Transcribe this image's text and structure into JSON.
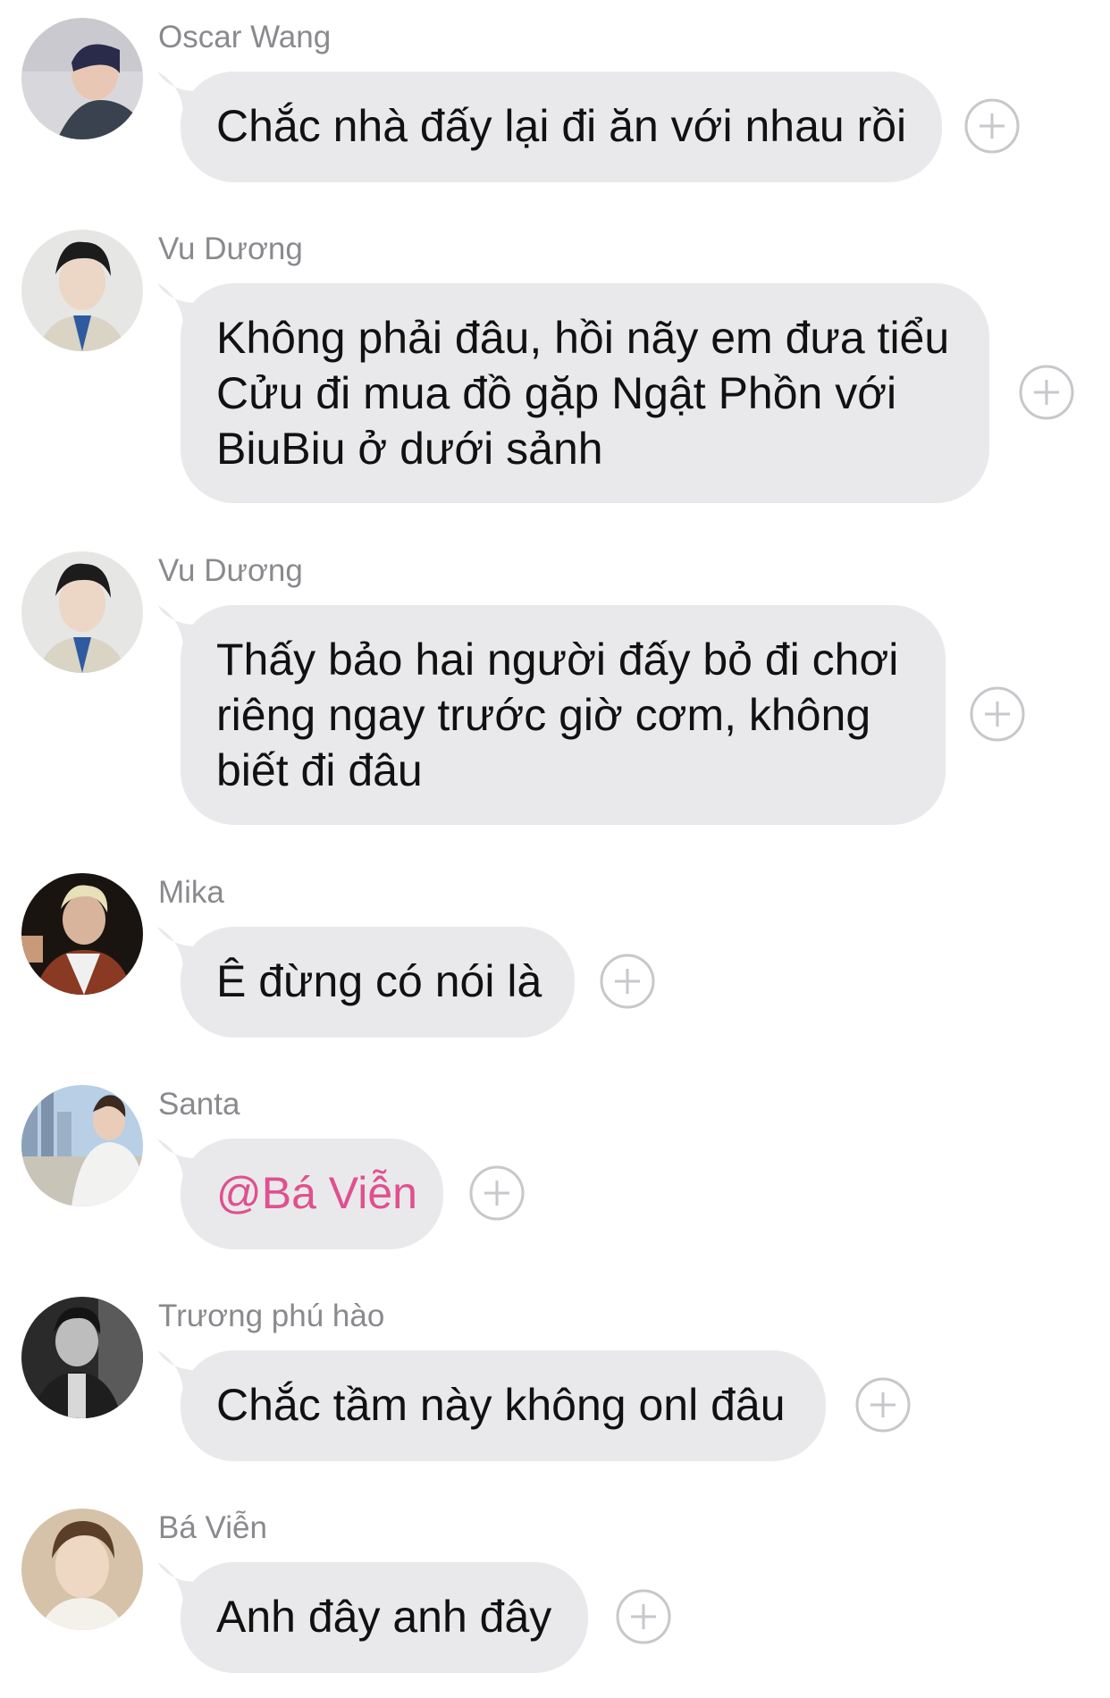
{
  "messages": [
    {
      "sender": "Oscar Wang",
      "text": "Chắc nhà đấy lại đi ăn với nhau rồi",
      "avatar_icon": "avatar-oscar-wang"
    },
    {
      "sender": "Vu Dương",
      "text": "Không phải đâu, hồi nãy em đưa tiểu Cửu đi mua đồ gặp Ngật Phồn với BiuBiu ở dưới sảnh",
      "avatar_icon": "avatar-vu-duong"
    },
    {
      "sender": "Vu Dương",
      "text": "Thấy bảo hai người đấy bỏ đi chơi riêng ngay trước giờ cơm, không biết đi đâu",
      "avatar_icon": "avatar-vu-duong"
    },
    {
      "sender": "Mika",
      "text": "Ê đừng có nói là",
      "avatar_icon": "avatar-mika"
    },
    {
      "sender": "Santa",
      "text": "@Bá Viễn",
      "avatar_icon": "avatar-santa"
    },
    {
      "sender": "Trương phú hào",
      "text": "Chắc tầm này không onl đâu",
      "avatar_icon": "avatar-truong-phu-hao"
    },
    {
      "sender": "Bá Viễn",
      "text": "Anh đây anh đây",
      "avatar_icon": "avatar-ba-vien"
    }
  ],
  "colors": {
    "bubble": "#e9e9eb",
    "sender_name": "#8a8a8e",
    "mention": "#e0508e",
    "add_reaction_icon": "#c7c7cc"
  },
  "icons": {
    "add_reaction": "plus-circle-icon"
  }
}
